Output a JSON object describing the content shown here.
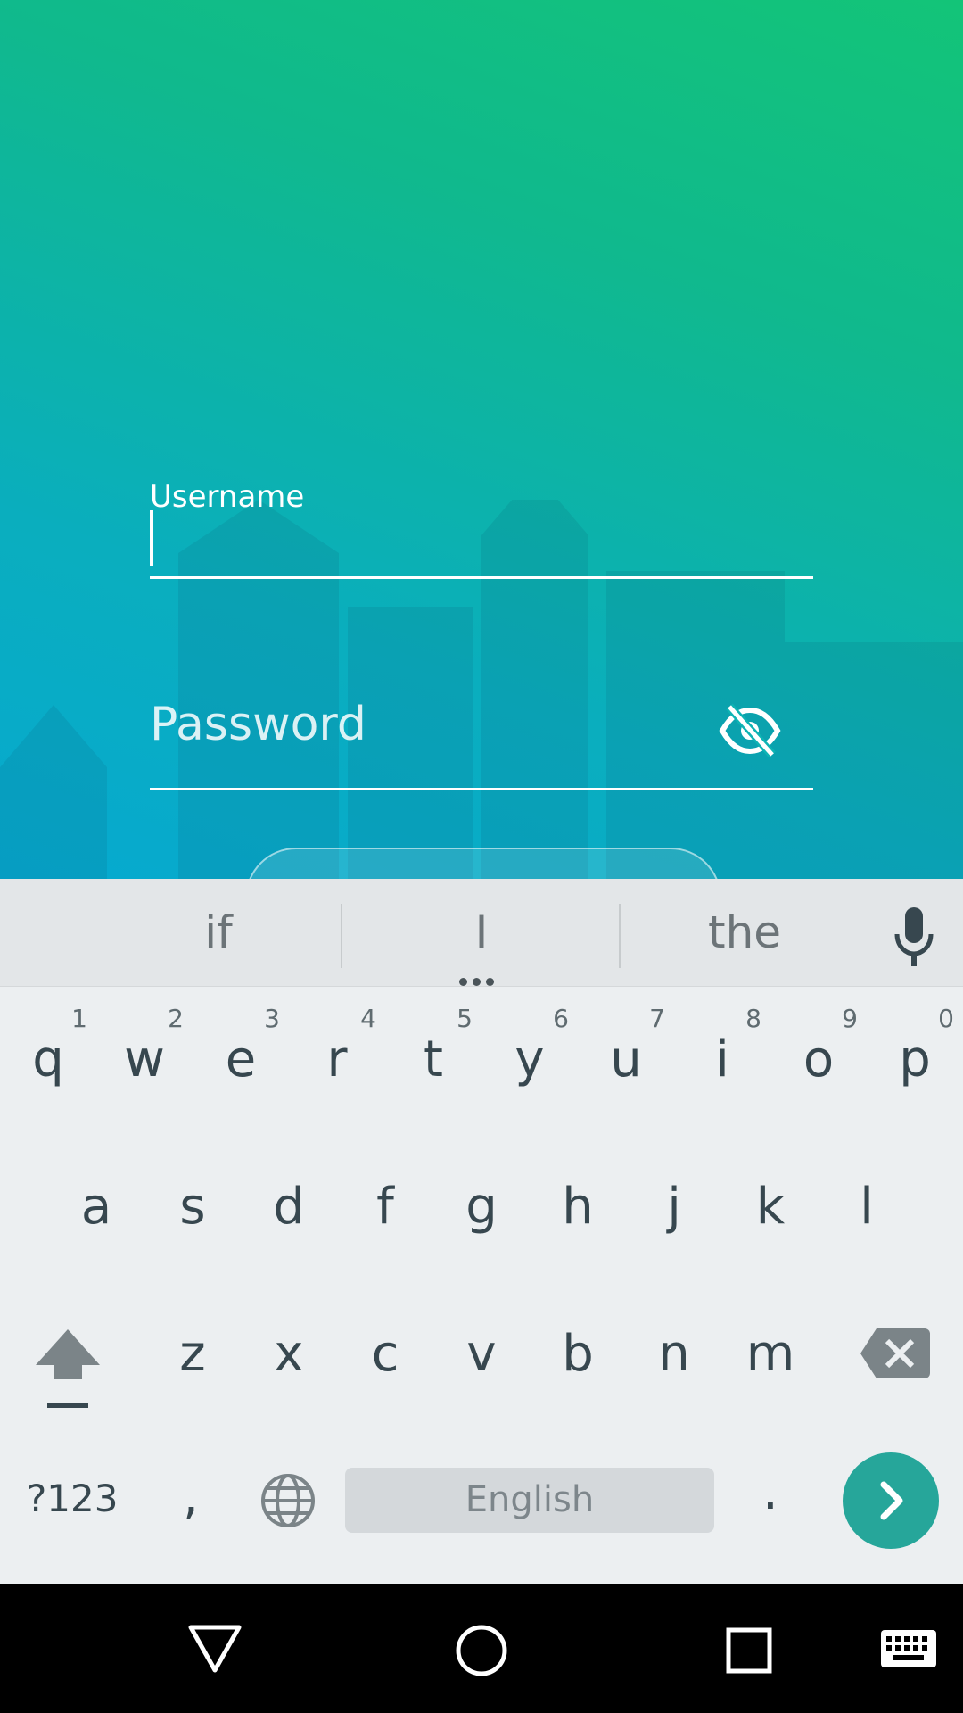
{
  "form": {
    "username_label": "Username",
    "username_value": "",
    "password_placeholder": "Password"
  },
  "keyboard": {
    "suggestions": [
      "if",
      "I",
      "the"
    ],
    "row1": [
      {
        "ch": "q",
        "sup": "1"
      },
      {
        "ch": "w",
        "sup": "2"
      },
      {
        "ch": "e",
        "sup": "3"
      },
      {
        "ch": "r",
        "sup": "4"
      },
      {
        "ch": "t",
        "sup": "5"
      },
      {
        "ch": "y",
        "sup": "6"
      },
      {
        "ch": "u",
        "sup": "7"
      },
      {
        "ch": "i",
        "sup": "8"
      },
      {
        "ch": "o",
        "sup": "9"
      },
      {
        "ch": "p",
        "sup": "0"
      }
    ],
    "row2": [
      "a",
      "s",
      "d",
      "f",
      "g",
      "h",
      "j",
      "k",
      "l"
    ],
    "row3": [
      "z",
      "x",
      "c",
      "v",
      "b",
      "n",
      "m"
    ],
    "symbols_label": "?123",
    "comma_label": ",",
    "space_label": "English",
    "period_label": "."
  },
  "colors": {
    "accent": "#26a69a",
    "gradient_top": "#13c478",
    "gradient_bottom": "#06a9d0"
  }
}
